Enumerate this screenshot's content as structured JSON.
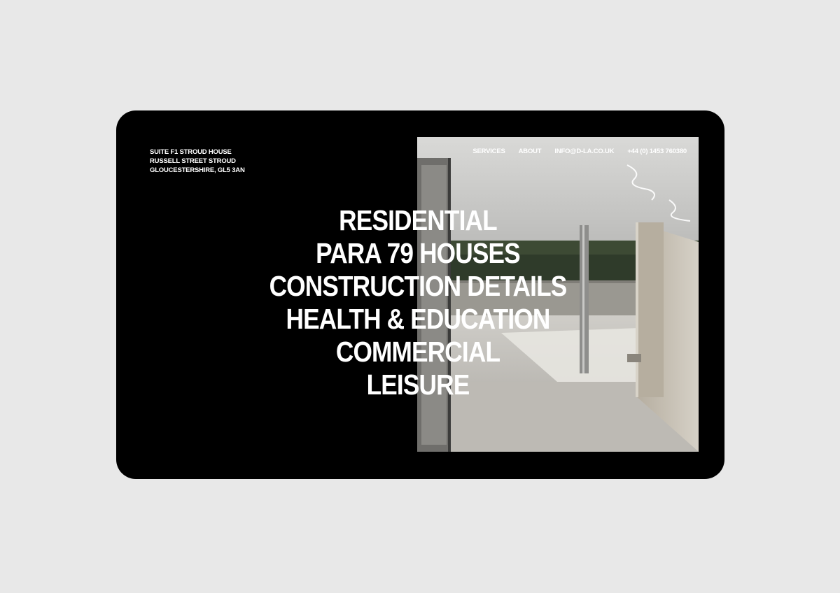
{
  "address": {
    "line1": "SUITE F1 STROUD HOUSE",
    "line2": "RUSSELL STREET STROUD",
    "line3": "GLOUCESTERSHIRE, GL5 3AN"
  },
  "nav": {
    "services": "SERVICES",
    "about": "ABOUT",
    "email": "INFO@D-LA.CO.UK",
    "phone": "+44 (0) 1453 760380"
  },
  "menu": {
    "items": [
      "RESIDENTIAL",
      "PARA 79 HOUSES",
      "CONSTRUCTION DETAILS",
      "HEALTH & EDUCATION",
      "COMMERCIAL",
      "LEISURE"
    ]
  },
  "colors": {
    "page_background": "#e8e8e8",
    "screen_background": "#000000",
    "text": "#ffffff"
  },
  "image": {
    "subject": "pavilion-photo"
  }
}
